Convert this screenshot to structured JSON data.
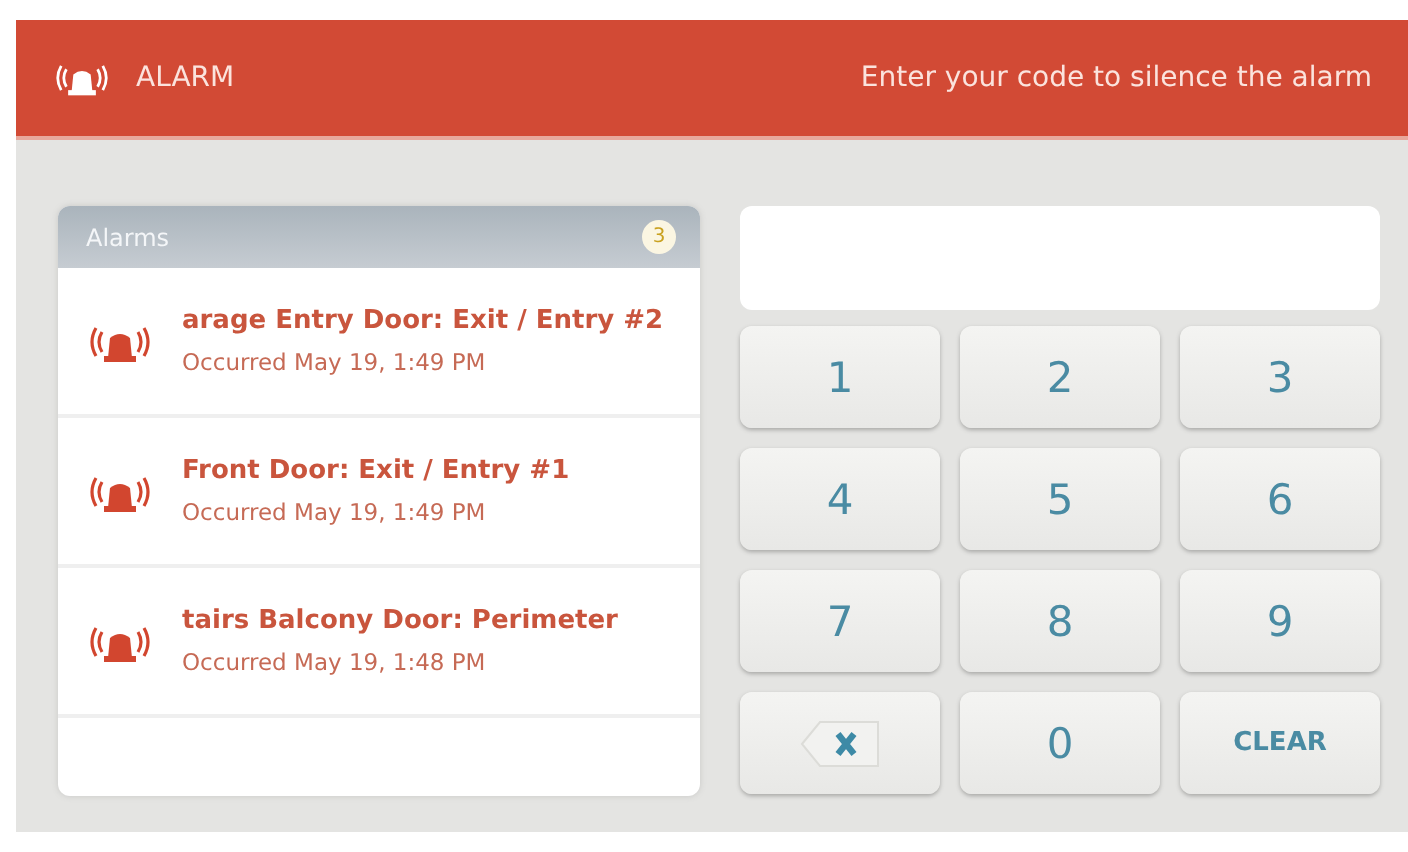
{
  "header": {
    "title": "ALARM",
    "prompt": "Enter your code to silence the alarm"
  },
  "alarms_panel": {
    "title": "Alarms",
    "count": "3",
    "items": [
      {
        "name": "arage Entry Door: Exit / Entry #2",
        "time": "Occurred May 19, 1:49 PM"
      },
      {
        "name": "Front Door: Exit / Entry #1",
        "time": "Occurred May 19, 1:49 PM"
      },
      {
        "name": "tairs Balcony Door: Perimeter",
        "time": "Occurred May 19, 1:48 PM"
      }
    ]
  },
  "keypad": {
    "keys": [
      {
        "kind": "digit",
        "label": "1"
      },
      {
        "kind": "digit",
        "label": "2"
      },
      {
        "kind": "digit",
        "label": "3"
      },
      {
        "kind": "digit",
        "label": "4"
      },
      {
        "kind": "digit",
        "label": "5"
      },
      {
        "kind": "digit",
        "label": "6"
      },
      {
        "kind": "digit",
        "label": "7"
      },
      {
        "kind": "digit",
        "label": "8"
      },
      {
        "kind": "digit",
        "label": "9"
      },
      {
        "kind": "backspace"
      },
      {
        "kind": "digit",
        "label": "0"
      },
      {
        "kind": "word",
        "label": "CLEAR"
      }
    ]
  }
}
